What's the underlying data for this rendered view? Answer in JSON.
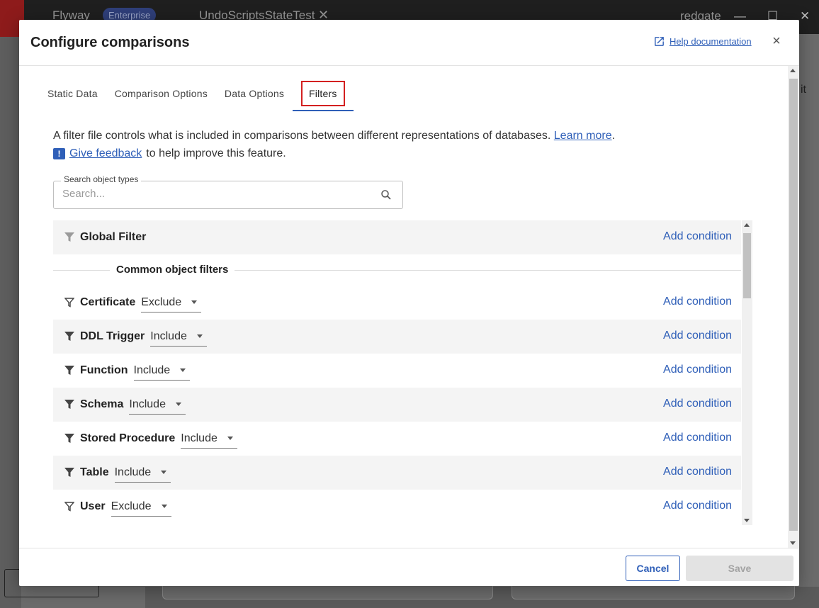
{
  "app": {
    "title": "Flyway",
    "edition_badge": "Enterprise",
    "tab_name": "UndoScriptsStateTest",
    "user": "redgate",
    "partial_right_text": "it"
  },
  "dialog": {
    "title": "Configure comparisons",
    "help_label": "Help documentation",
    "close_label": "×"
  },
  "tabs": [
    {
      "label": "Static Data"
    },
    {
      "label": "Comparison Options"
    },
    {
      "label": "Data Options"
    },
    {
      "label": "Filters"
    }
  ],
  "intro": {
    "text": "A filter file controls what is included in comparisons between different representations of databases.",
    "learn_more": "Learn more",
    "period": ".",
    "feedback_link": "Give feedback",
    "feedback_rest": "to help improve this feature."
  },
  "search": {
    "label": "Search object types",
    "placeholder": "Search..."
  },
  "global_filter": {
    "name": "Global Filter",
    "add_condition": "Add condition"
  },
  "common_heading": "Common object filters",
  "filters": [
    {
      "name": "Certificate",
      "mode": "Exclude",
      "add_condition": "Add condition"
    },
    {
      "name": "DDL Trigger",
      "mode": "Include",
      "add_condition": "Add condition"
    },
    {
      "name": "Function",
      "mode": "Include",
      "add_condition": "Add condition"
    },
    {
      "name": "Schema",
      "mode": "Include",
      "add_condition": "Add condition"
    },
    {
      "name": "Stored Procedure",
      "mode": "Include",
      "add_condition": "Add condition"
    },
    {
      "name": "Table",
      "mode": "Include",
      "add_condition": "Add condition"
    },
    {
      "name": "User",
      "mode": "Exclude",
      "add_condition": "Add condition"
    }
  ],
  "footer": {
    "cancel": "Cancel",
    "save": "Save"
  },
  "colors": {
    "accent": "#2f5fb8",
    "active_tab_highlight": "#d32020"
  }
}
